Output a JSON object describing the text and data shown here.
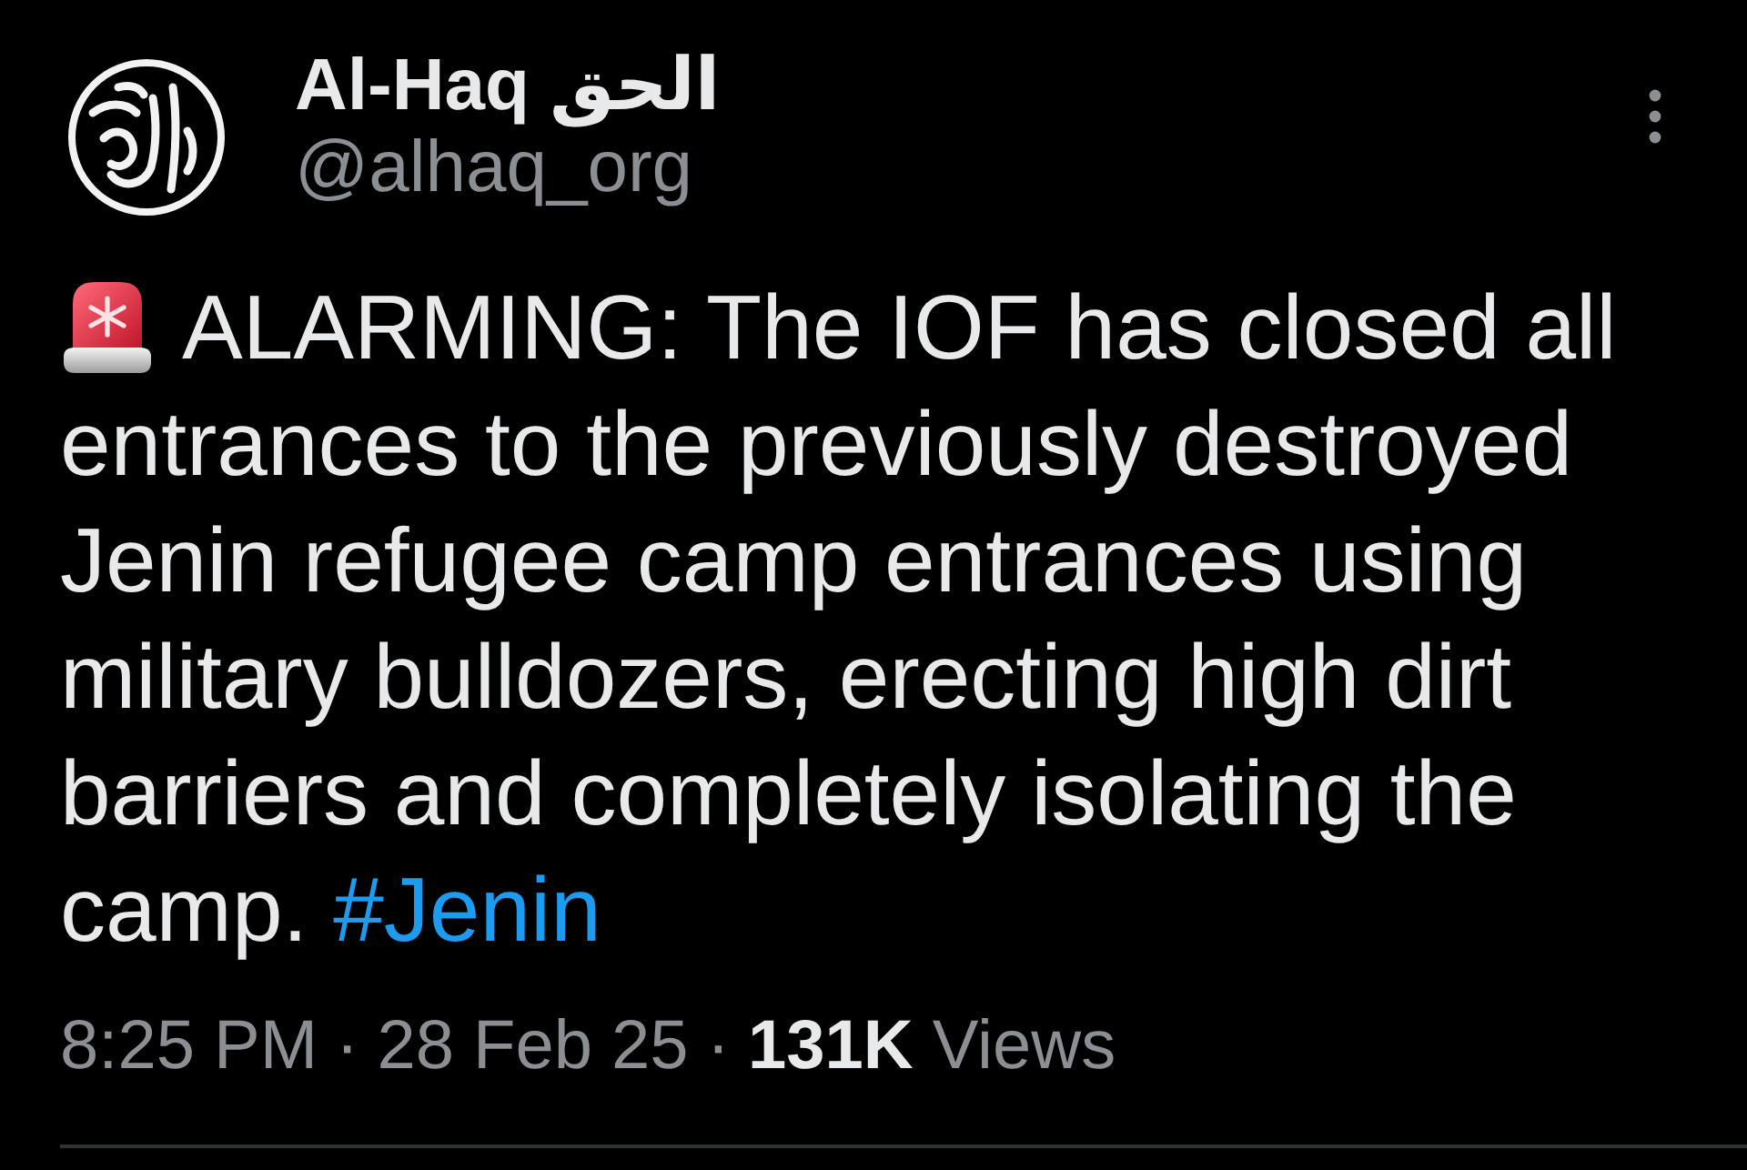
{
  "author": {
    "name": "Al-Haq الحق",
    "handle": "@alhaq_org"
  },
  "body": [
    {
      "kind": "text",
      "text": "ALARMING: The IOF has closed all entrances to the previously destroyed Jenin refugee camp entrances using military bulldozers, erecting high dirt barriers and completely isolating the camp."
    },
    {
      "kind": "hashtag",
      "text": "#Jenin"
    }
  ],
  "meta": [
    {
      "kind": "time",
      "text": "8:25 PM"
    },
    {
      "kind": "separator",
      "text": "·"
    },
    {
      "kind": "date",
      "text": "28 Feb 25"
    },
    {
      "kind": "separator",
      "text": "·"
    },
    {
      "kind": "views",
      "text": "**131K** Views"
    }
  ]
}
